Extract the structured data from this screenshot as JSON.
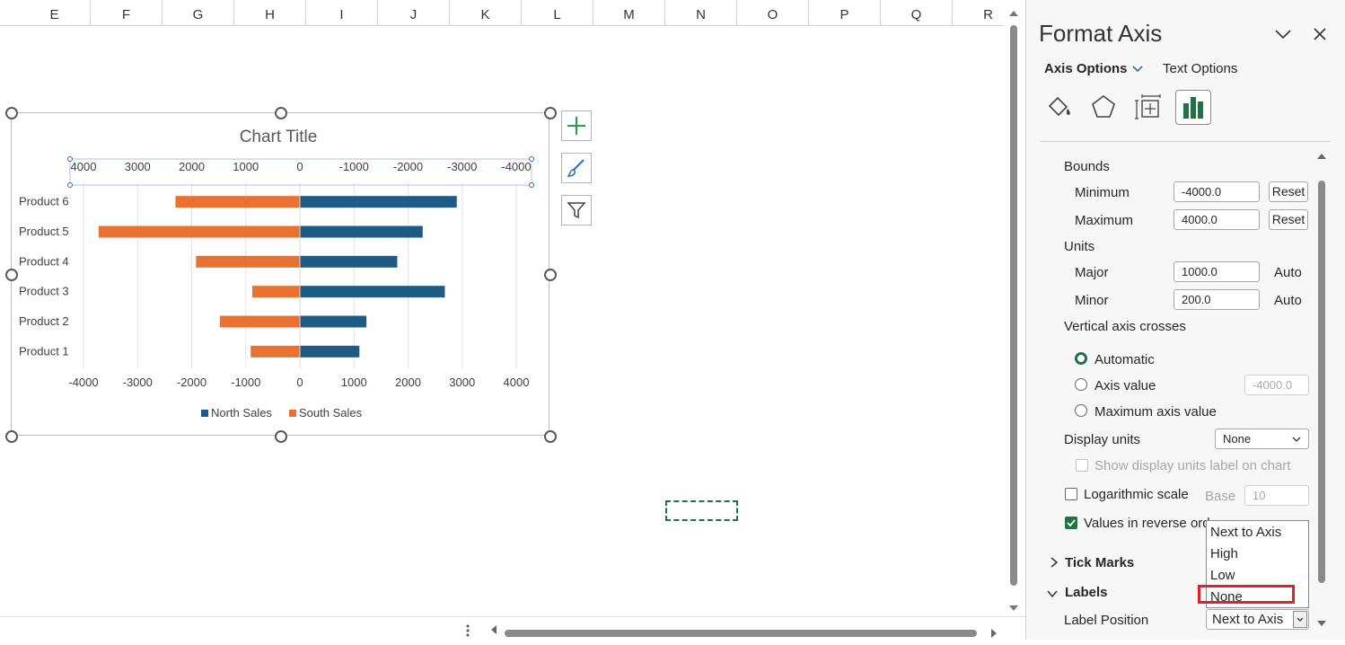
{
  "sheet": {
    "columns": [
      "E",
      "F",
      "G",
      "H",
      "I",
      "J",
      "K",
      "L",
      "M",
      "N",
      "O",
      "P",
      "Q",
      "R"
    ]
  },
  "chart": {
    "side_buttons": [
      "plus-icon",
      "brush-icon",
      "filter-icon"
    ]
  },
  "chart_data": {
    "type": "bar",
    "orientation": "horizontal",
    "title": "Chart Title",
    "categories": [
      "Product 1",
      "Product 2",
      "Product 3",
      "Product 4",
      "Product 5",
      "Product 6"
    ],
    "series": [
      {
        "name": "North Sales",
        "color": "#1f5c85",
        "values": [
          1100,
          1230,
          2680,
          1800,
          2270,
          2900
        ]
      },
      {
        "name": "South Sales",
        "color": "#e97132",
        "values": [
          -910,
          -1480,
          -880,
          -1920,
          -3720,
          -2300
        ]
      }
    ],
    "xlim": [
      -4000,
      4000
    ],
    "xticks": [
      "-4000",
      "-3000",
      "-2000",
      "-1000",
      "0",
      "1000",
      "2000",
      "3000",
      "4000"
    ],
    "top_axis_ticks": [
      "4000",
      "3000",
      "2000",
      "1000",
      "0",
      "-1000",
      "-2000",
      "-3000",
      "-4000"
    ],
    "grid": true,
    "legend": "bottom"
  },
  "pane": {
    "title": "Format Axis",
    "tab_axis_options": "Axis Options",
    "tab_text_options": "Text Options",
    "bounds_label": "Bounds",
    "minimum_label": "Minimum",
    "minimum_value": "-4000.0",
    "maximum_label": "Maximum",
    "maximum_value": "4000.0",
    "reset_label": "Reset",
    "units_label": "Units",
    "major_label": "Major",
    "major_value": "1000.0",
    "minor_label": "Minor",
    "minor_value": "200.0",
    "auto_label": "Auto",
    "vertical_crosses_label": "Vertical axis crosses",
    "automatic_label": "Automatic",
    "axis_value_label": "Axis value",
    "axis_value_value": "-4000.0",
    "max_axis_value_label": "Maximum axis value",
    "display_units_label": "Display units",
    "display_units_value": "None",
    "show_units_label": "Show display units label on chart",
    "log_scale_label": "Logarithmic scale",
    "base_label": "Base",
    "base_value": "10",
    "reverse_order_label": "Values in reverse ord",
    "tick_marks_label": "Tick Marks",
    "labels_label": "Labels",
    "label_position_label": "Label Position",
    "label_position_value": "Next to Axis",
    "dropdown_options": [
      "Next to Axis",
      "High",
      "Low",
      "None"
    ],
    "highlighted_option": "None",
    "accent_color": "#217346"
  }
}
